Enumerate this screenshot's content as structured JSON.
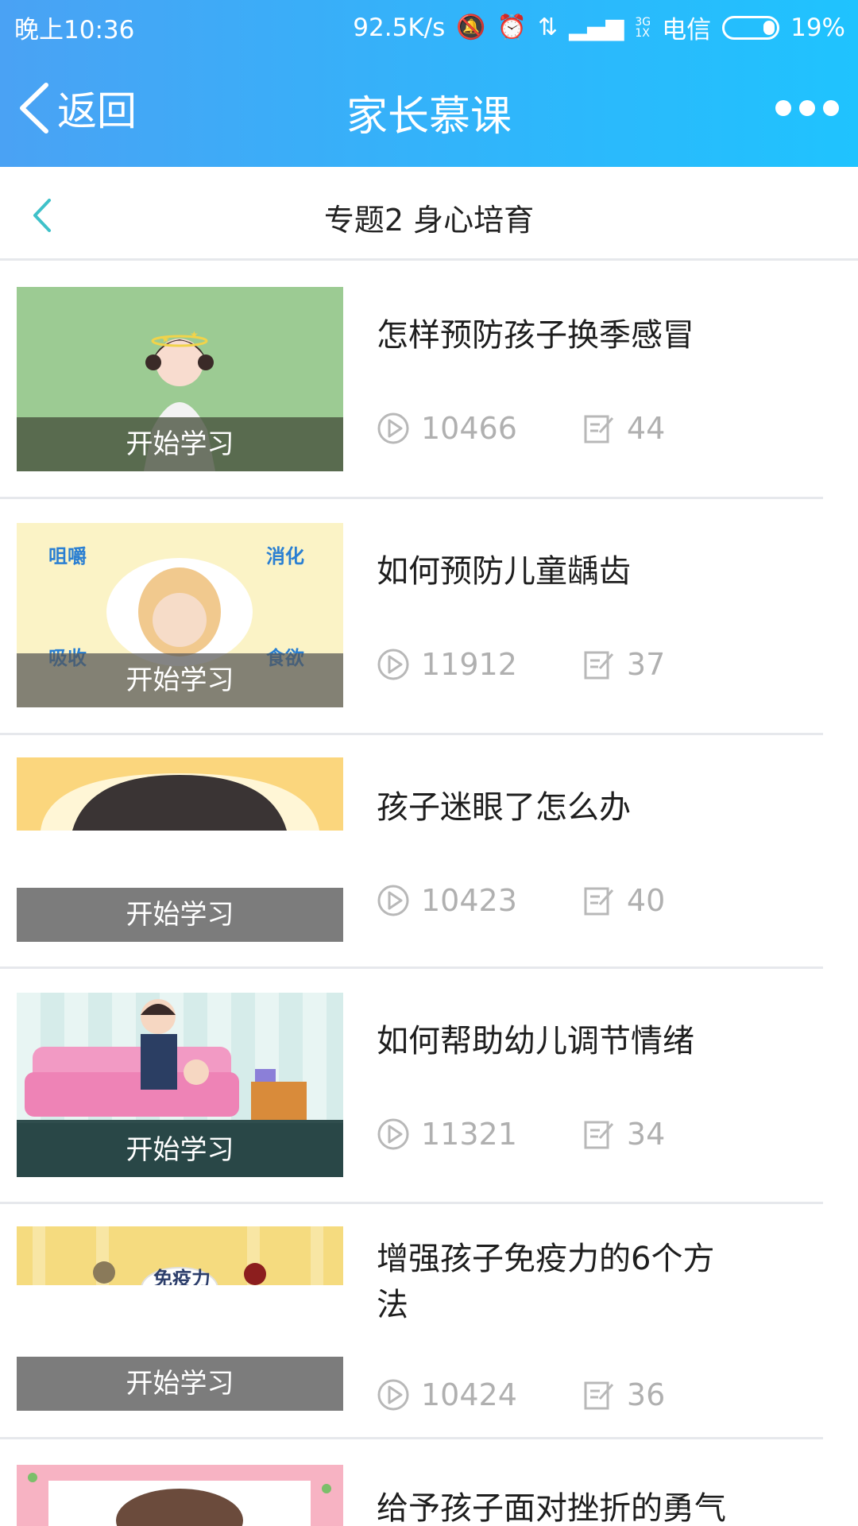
{
  "status_bar": {
    "time": "晚上10:36",
    "speed": "92.5K/s",
    "network_top": "3G",
    "network_bottom": "1X",
    "carrier": "电信",
    "battery": "19%"
  },
  "nav": {
    "back_label": "返回",
    "title": "家长慕课"
  },
  "subheader": {
    "title": "专题2 身心培育"
  },
  "courses": [
    {
      "title": "怎样预防孩子换季感冒",
      "plays": "10466",
      "comments": "44",
      "cta": "开始学习"
    },
    {
      "title": "如何预防儿童龋齿",
      "plays": "11912",
      "comments": "37",
      "cta": "开始学习",
      "thumb_labels": [
        "咀嚼",
        "消化",
        "吸收",
        "食欲"
      ]
    },
    {
      "title": "孩子迷眼了怎么办",
      "plays": "10423",
      "comments": "40",
      "cta": "开始学习"
    },
    {
      "title": "如何帮助幼儿调节情绪",
      "plays": "11321",
      "comments": "34",
      "cta": "开始学习"
    },
    {
      "title": "增强孩子免疫力的6个方法",
      "plays": "10424",
      "comments": "36",
      "cta": "开始学习",
      "thumb_labels": [
        "免疫力"
      ]
    },
    {
      "title": "给予孩子面对挫折的勇气",
      "plays": "",
      "comments": "",
      "cta": ""
    }
  ],
  "colors": {
    "header_start": "#4aa2f4",
    "header_end": "#1fc3fe",
    "sub_back_icon": "#3fc1c9",
    "stat_gray": "#b0b0b0"
  }
}
